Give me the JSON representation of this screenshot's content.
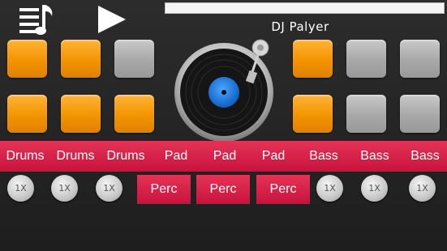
{
  "header": {
    "title": "DJ Palyer",
    "playlist_icon": "playlist-music-icon",
    "play_icon": "play-icon",
    "progress": 0
  },
  "colors": {
    "pad_on": "#f39400",
    "pad_off": "#a8a8a8",
    "label_red": "#d81b45",
    "record_label": "#1a7be0"
  },
  "pads": {
    "row1": [
      true,
      true,
      false,
      true,
      false,
      false
    ],
    "row2": [
      true,
      true,
      true,
      true,
      false,
      false
    ]
  },
  "turntable": {
    "icon": "vinyl-record-icon"
  },
  "labels": [
    "Drums",
    "Drums",
    "Drums",
    "Pad",
    "Pad",
    "Pad",
    "Bass",
    "Bass",
    "Bass"
  ],
  "perc": [
    "Perc",
    "Perc",
    "Perc"
  ],
  "rates": [
    "1X",
    "1X",
    "1X",
    "1X",
    "1X",
    "1X"
  ]
}
